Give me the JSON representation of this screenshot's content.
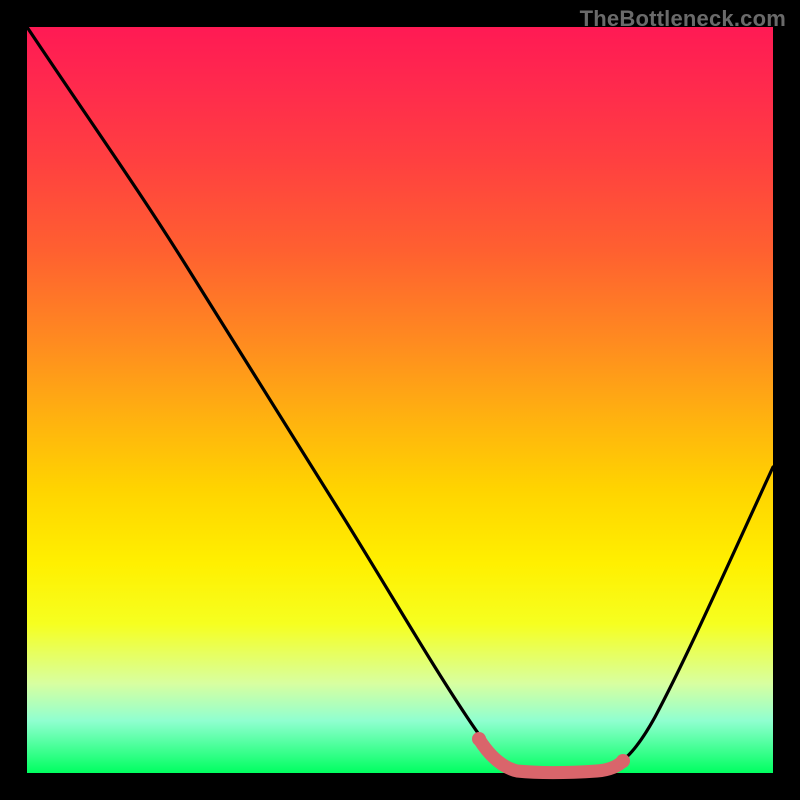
{
  "watermark": "TheBottleneck.com",
  "colors": {
    "frame": "#000000",
    "curve": "#000000",
    "accent": "#d9656b"
  },
  "chart_data": {
    "type": "line",
    "title": "",
    "xlabel": "",
    "ylabel": "",
    "xlim": [
      0,
      100
    ],
    "ylim": [
      0,
      100
    ],
    "grid": false,
    "legend": false,
    "series": [
      {
        "name": "bottleneck-curve",
        "x": [
          0,
          5,
          10,
          15,
          20,
          25,
          30,
          35,
          40,
          45,
          50,
          55,
          60,
          62,
          65,
          70,
          73,
          78,
          82,
          86,
          90,
          94,
          100
        ],
        "y": [
          100,
          94,
          88,
          81,
          74,
          67,
          60,
          52,
          44,
          36,
          28,
          20,
          11,
          6,
          2,
          0,
          0,
          0,
          4,
          12,
          22,
          34,
          55
        ]
      },
      {
        "name": "accent-segment",
        "x": [
          62,
          65,
          70,
          73,
          78
        ],
        "y": [
          6,
          2,
          0,
          0,
          0
        ]
      }
    ]
  }
}
